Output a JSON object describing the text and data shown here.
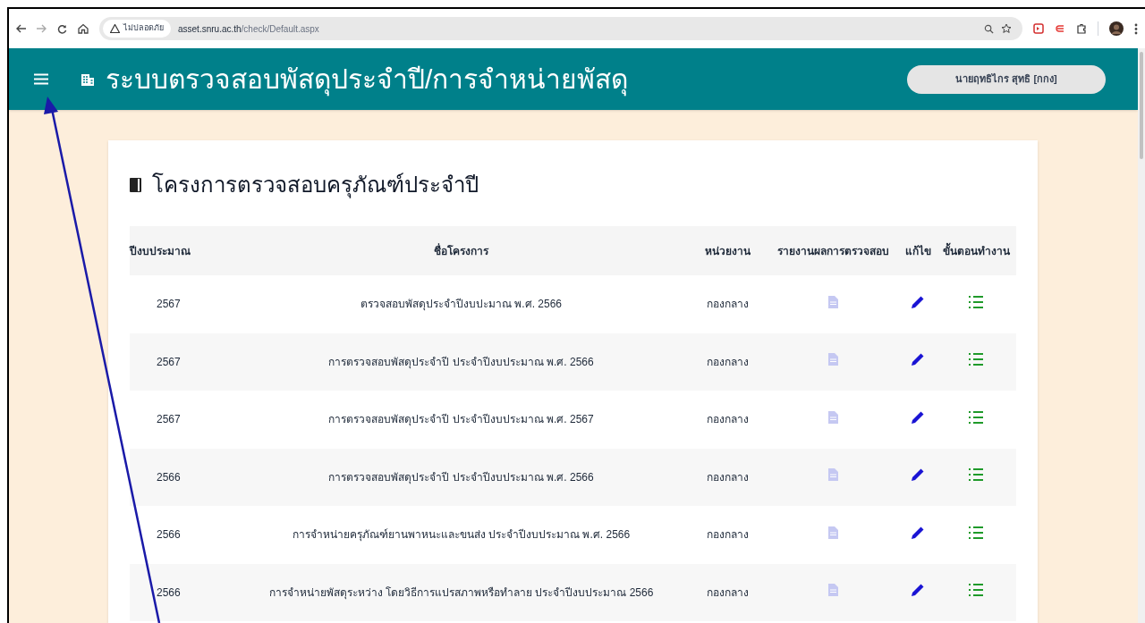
{
  "browser": {
    "security_label": "ไม่ปลอดภัย",
    "url_host": "asset.snru.ac.th",
    "url_path": "/check/Default.aspx"
  },
  "header": {
    "title": "ระบบตรวจสอบพัสดุประจำปี/การจำหน่ายพัสดุ",
    "user": "นายฤทธิไกร สุทธิ [กกง]"
  },
  "card": {
    "title": "โครงการตรวจสอบครุภัณฑ์ประจำปี"
  },
  "table": {
    "columns": [
      "ปีงบประมาณ",
      "ชื่อโครงการ",
      "หน่วยงาน",
      "รายงานผลการตรวจสอบ",
      "แก้ไข",
      "ขั้นตอนทำงาน"
    ],
    "rows": [
      {
        "year": "2567",
        "name": "ตรวจสอบพัสดุประจำปีงบปะมาณ พ.ศ. 2566",
        "unit": "กองกลาง"
      },
      {
        "year": "2567",
        "name": "การตรวจสอบพัสดุประจำปี ประจำปีงบประมาณ พ.ศ. 2566",
        "unit": "กองกลาง"
      },
      {
        "year": "2567",
        "name": "การตรวจสอบพัสดุประจำปี ประจำปีงบประมาณ พ.ศ. 2567",
        "unit": "กองกลาง"
      },
      {
        "year": "2566",
        "name": "การตรวจสอบพัสดุประจำปี ประจำปีงบประมาณ พ.ศ. 2566",
        "unit": "กองกลาง"
      },
      {
        "year": "2566",
        "name": "การจำหน่ายครุภัณฑ์ยานพาหนะและขนส่ง ประจำปีงบประมาณ พ.ศ. 2566",
        "unit": "กองกลาง"
      },
      {
        "year": "2566",
        "name": "การจำหน่ายพัสดุระหว่าง โดยวิธีการแปรสภาพหรือทำลาย ประจำปีงบประมาณ 2566",
        "unit": "กองกลาง"
      }
    ]
  }
}
